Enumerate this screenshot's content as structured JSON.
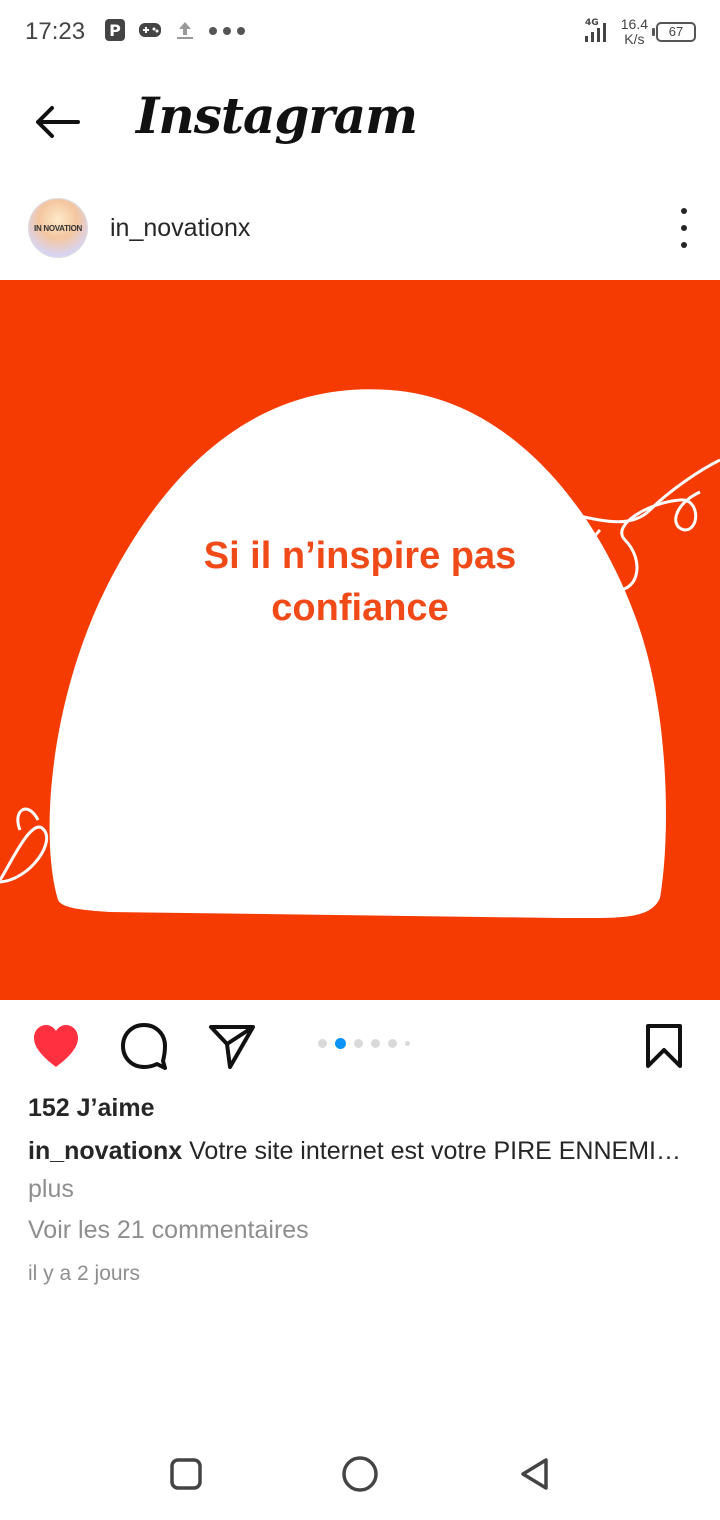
{
  "status_bar": {
    "time": "17:23",
    "network": "4G",
    "speed_value": "16.4",
    "speed_unit": "K/s",
    "battery": "67"
  },
  "header": {
    "app_title": "Instagram"
  },
  "post": {
    "username": "in_novationx",
    "avatar_text": "IN NOVATION",
    "slide_text_line1": "Si il n’inspire pas",
    "slide_text_line2": "confiance",
    "image_bg_color": "#f53b02",
    "slide_count": 6,
    "active_slide": 2,
    "likes": "152 J’aime",
    "caption_user": "in_novationx",
    "caption_text": "Votre site internet est votre PIRE ENNEMI…",
    "caption_more": "plus",
    "comments_link": "Voir les 21 commentaires",
    "time_ago": "il y a 2 jours"
  },
  "icons": {
    "back": "arrow-left-icon",
    "more": "more-vertical-icon",
    "like": "heart-filled-icon",
    "comment": "comment-icon",
    "share": "paper-plane-icon",
    "save": "bookmark-icon"
  },
  "colors": {
    "like_red": "#ff3040",
    "active_dot": "#0a95f6",
    "muted_text": "#8e8e8e"
  }
}
